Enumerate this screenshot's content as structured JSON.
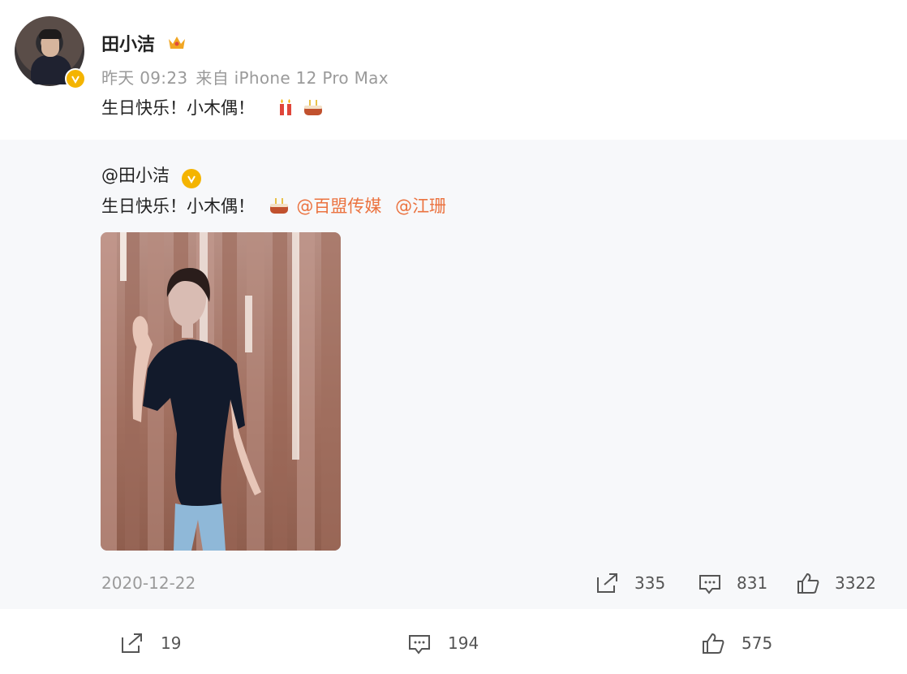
{
  "post": {
    "username": "田小洁",
    "time": "昨天 09:23",
    "source": "来自 iPhone 12 Pro Max",
    "text": "生日快乐！小木偶！"
  },
  "repost": {
    "user": "@田小洁",
    "text": "生日快乐！小木偶！",
    "mentions": [
      "@百盟传媒",
      "@江珊"
    ],
    "date": "2020-12-22",
    "stats": {
      "reposts": "335",
      "comments": "831",
      "likes": "3322"
    }
  },
  "actions": {
    "reposts": "19",
    "comments": "194",
    "likes": "575"
  },
  "colors": {
    "mention": "#eb7340",
    "verified": "#f4b400",
    "repost_bg": "#f7f8fa"
  },
  "icons": [
    "verified-icon",
    "crown-icon",
    "candle-emoji",
    "cake-emoji",
    "share-icon",
    "comment-icon",
    "like-icon"
  ]
}
